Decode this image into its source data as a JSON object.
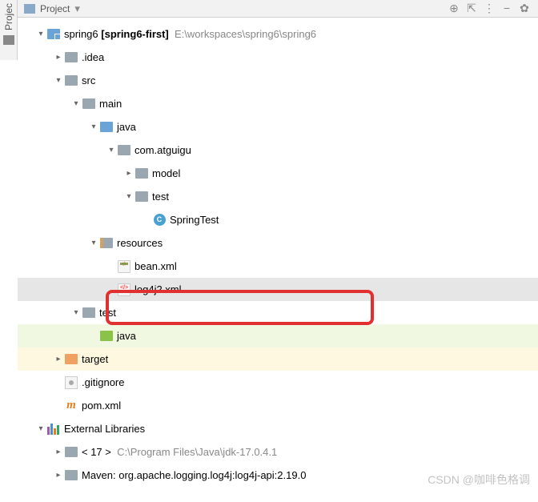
{
  "header": {
    "title": "Project",
    "collapse_btn": "−",
    "dropdown_icon": "▾"
  },
  "sidebar": {
    "label": "Projec"
  },
  "tree": {
    "root": {
      "name": "spring6",
      "bold": "[spring6-first]",
      "path": "E:\\workspaces\\spring6\\spring6"
    },
    "idea": ".idea",
    "src": "src",
    "main": "main",
    "java_main": "java",
    "package": "com.atguigu",
    "model": "model",
    "test_pkg": "test",
    "spring_test": "SpringTest",
    "resources": "resources",
    "bean_xml": "bean.xml",
    "log4j2_xml": "log4j2.xml",
    "test_dir": "test",
    "java_test": "java",
    "target": "target",
    "gitignore": ".gitignore",
    "pom": "pom.xml",
    "ext_libs": "External Libraries",
    "jdk_prefix": "< 17 >",
    "jdk_path": "C:\\Program Files\\Java\\jdk-17.0.4.1",
    "maven_lib": "Maven: org.apache.logging.log4j:log4j-api:2.19.0"
  },
  "watermark": "CSDN @咖啡色格调"
}
